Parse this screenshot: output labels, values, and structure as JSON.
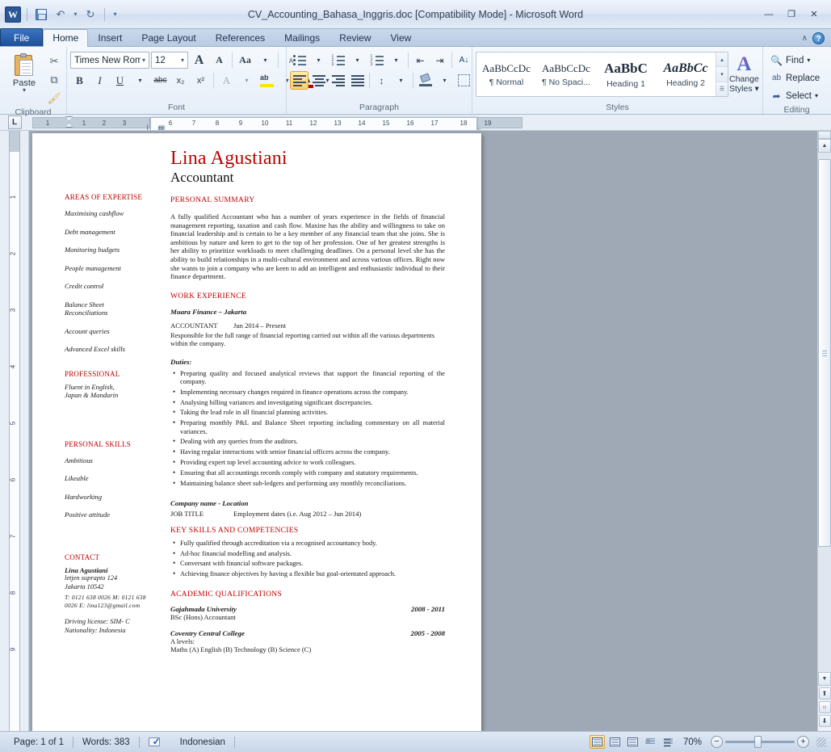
{
  "window": {
    "title": "CV_Accounting_Bahasa_Inggris.doc [Compatibility Mode]  -  Microsoft Word",
    "app_badge": "W",
    "minimize": "—",
    "restore": "❐",
    "close": "✕",
    "qat": {
      "save": "save-icon",
      "undo": "↶",
      "undo_caret": "▾",
      "redo": "↻",
      "customize": "▾"
    }
  },
  "tabs": [
    {
      "label": "File",
      "type": "file"
    },
    {
      "label": "Home",
      "type": "active"
    },
    {
      "label": "Insert",
      "type": "normal"
    },
    {
      "label": "Page Layout",
      "type": "normal"
    },
    {
      "label": "References",
      "type": "normal"
    },
    {
      "label": "Mailings",
      "type": "normal"
    },
    {
      "label": "Review",
      "type": "normal"
    },
    {
      "label": "View",
      "type": "normal"
    }
  ],
  "tab_right": {
    "minimize_ribbon": "∧",
    "help": "?"
  },
  "ribbon": {
    "clipboard": {
      "label": "Clipboard",
      "paste": "Paste",
      "paste_caret": "▾",
      "cut": "✂",
      "copy": "⧉",
      "format_painter": "🖌",
      "dialog_launcher": "↘"
    },
    "font": {
      "label": "Font",
      "font_name": "Times New Rom",
      "font_size": "12",
      "grow_font": "A",
      "shrink_font": "A",
      "change_case": "Aa",
      "clear_formatting": "ᴀ",
      "bold": "B",
      "italic": "I",
      "underline": "U",
      "strikethrough": "abc",
      "subscript": "x₂",
      "superscript": "x²",
      "text_effects": "A",
      "highlight": "ab",
      "font_color": "A",
      "caret": "▾",
      "dialog_launcher": "↘"
    },
    "paragraph": {
      "label": "Paragraph",
      "bullets": "bullets-icon",
      "numbering": "numbering-icon",
      "multilevel": "multilevel-list-icon",
      "decrease_indent": "⇤",
      "increase_indent": "⇥",
      "sort": "A↓",
      "show_marks": "¶",
      "align_left": "align-left-icon",
      "align_center": "align-center-icon",
      "align_right": "align-right-icon",
      "justify": "justify-icon",
      "line_spacing": "↕",
      "shading": "shading-icon",
      "borders": "borders-icon",
      "caret": "▾",
      "dialog_launcher": "↘"
    },
    "styles": {
      "label": "Styles",
      "items": [
        {
          "preview": "AaBbCcDc",
          "name": "¶ Normal"
        },
        {
          "preview": "AaBbCcDc",
          "name": "¶ No Spaci..."
        },
        {
          "preview": "AaBbC",
          "name": "Heading 1"
        },
        {
          "preview": "AaBbCc",
          "name": "Heading 2"
        }
      ],
      "scroll_up": "▴",
      "scroll_down": "▾",
      "more": "☰",
      "change_styles_line1": "Change",
      "change_styles_line2": "Styles ▾",
      "dialog_launcher": "↘"
    },
    "editing": {
      "label": "Editing",
      "find": "Find",
      "find_caret": "▾",
      "replace": "Replace",
      "select": "Select",
      "select_caret": "▾",
      "find_icon": "binoculars-icon",
      "replace_icon": "replace-icon",
      "select_icon": "cursor-icon"
    }
  },
  "ruler": {
    "tab_selector": "L",
    "left_numbers": [
      "1",
      "1",
      "2",
      "3"
    ],
    "page_numbers": [
      "6",
      "7",
      "8",
      "9",
      "10",
      "11",
      "12",
      "13",
      "14",
      "15",
      "16",
      "17"
    ],
    "right_numbers": [
      "18",
      "19"
    ],
    "vertical_numbers": [
      "1",
      "2",
      "3",
      "4",
      "5",
      "6",
      "7",
      "8",
      "9"
    ]
  },
  "document": {
    "name": "Lina Agustiani",
    "role": "Accountant",
    "left_column": {
      "areas_heading": "AREAS OF EXPERTISE",
      "areas": [
        "Maximising cashflow",
        "Debt management",
        "Monitoring budgets",
        "People management",
        "Credit control",
        "Balance Sheet\nReconciliations",
        "Account queries",
        "Advanced Excel skills"
      ],
      "professional_heading": "PROFESSIONAL",
      "professional": "Fluent in English,\nJapan & Mandarin",
      "personal_skills_heading": "PERSONAL SKILLS",
      "personal_skills": [
        "Ambitious",
        "Likeable",
        "Hardworking",
        "Positive attitude"
      ],
      "contact_heading": "CONTACT",
      "contact_name": "Lina Agustiani",
      "contact_address1": "letjen suprapto 124",
      "contact_address2": "Jakarta 10542",
      "contact_phone": "T: 0121 638 0026 M: 0121 638 0026 E: lina123@gmail.com",
      "contact_extra1": "Driving license: SIM- C",
      "contact_extra2": "Nationality: Indonesia"
    },
    "right_column": {
      "summary_heading": "PERSONAL SUMMARY",
      "summary": "A fully qualified Accountant who has a number of years experience in the fields of financial management reporting, taxation and cash flow. Maxine has the ability and willingness to take on financial leadership and is certain to be a key member of any financial team that she joins. She is ambitious by nature and keen to get to the top of her profession. One of her greatest strengths is her ability to prioritize workloads to meet challenging deadlines. On a personal level she has the ability to build relationships in a multi-cultural environment and across various offices. Right now she wants to join a company who are keen to add an intelligent and enthusiastic individual to their finance department.",
      "work_heading": "WORK EXPERIENCE",
      "employer": "Muara Finance – Jakarta",
      "job_title": "ACCOUNTANT",
      "job_dates": "Jun 2014 – Present",
      "job_desc": "Responsible for the full range of financial reporting carried out within all the various departments within the company.",
      "duties_label": "Duties:",
      "duties": [
        "Preparing quality and focused analytical reviews that support the financial reporting of the company.",
        "Implementing necessary changes required in finance operations across the company.",
        "Analysing billing variances and investigating significant discrepancies.",
        "Taking the lead role in all financial planning activities.",
        "Preparing monthly P&L and Balance Sheet reporting including commentary on all material variances.",
        "Dealing with any queries from the auditors.",
        "Having regular interactions with senior financial officers across the company.",
        "Providing expert top level accounting advice to work colleagues.",
        "Ensuring that all accountings records comply with company and statutory requirements.",
        "Maintaining balance sheet sub-ledgers and performing any monthly reconciliations."
      ],
      "company2": "Company name - Location",
      "job_title2": "JOB TITLE",
      "job_dates2": "Employment dates (i.e. Aug 2012 – Jun 2014)",
      "skills_heading": "KEY SKILLS AND COMPETENCIES",
      "skills": [
        "Fully qualified through accreditation via a recognised accountancy body.",
        "Ad-hoc financial modelling and analysis.",
        "Conversant with financial software packages.",
        "Achieving finance objectives by having a flexible but goal-orientated approach."
      ],
      "academic_heading": "ACADEMIC QUALIFICATIONS",
      "education": [
        {
          "school": "Gajahmada University",
          "years": "2008 - 2011",
          "detail": "BSc (Hons)          Accountant"
        },
        {
          "school": "Coventry Central College",
          "years": "2005 - 2008",
          "detail": "A levels:\nMaths (A) English (B) Technology (B) Science (C)"
        }
      ]
    }
  },
  "scrollbar": {
    "up": "▲",
    "down": "▼",
    "prev_page": "⬆",
    "browse_object": "○",
    "next_page": "⬇",
    "split": "split-handle"
  },
  "status": {
    "page": "Page: 1 of 1",
    "words": "Words: 383",
    "proofing": "proofing-icon",
    "language": "Indonesian",
    "views": [
      {
        "name": "print-layout",
        "active": true
      },
      {
        "name": "full-screen-reading",
        "active": false
      },
      {
        "name": "web-layout",
        "active": false
      },
      {
        "name": "outline",
        "active": false
      },
      {
        "name": "draft",
        "active": false
      }
    ],
    "zoom": "70%",
    "zoom_out": "−",
    "zoom_in": "+"
  }
}
